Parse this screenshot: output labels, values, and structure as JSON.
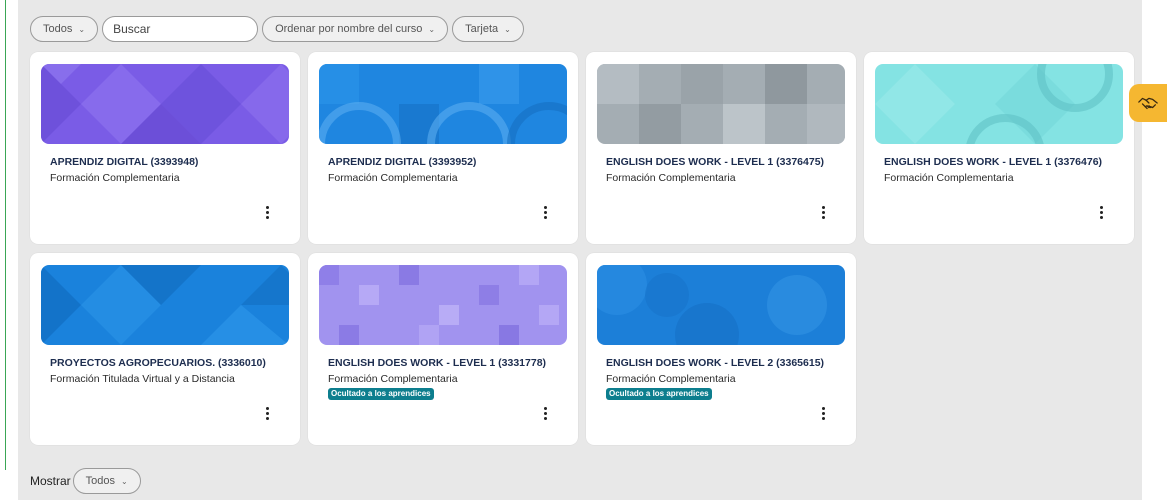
{
  "toolbar": {
    "filter_label": "Todos",
    "search_placeholder": "Buscar",
    "sort_label": "Ordenar por nombre del curso",
    "view_label": "Tarjeta"
  },
  "courses": [
    {
      "title": "APRENDIZ DIGITAL (3393948)",
      "category": "Formación Complementaria",
      "banner_color": "#7a5ce6",
      "hidden_badge": ""
    },
    {
      "title": "APRENDIZ DIGITAL (3393952)",
      "category": "Formación Complementaria",
      "banner_color": "#1f86e0",
      "hidden_badge": ""
    },
    {
      "title": "ENGLISH DOES WORK - LEVEL 1 (3376475)",
      "category": "Formación Complementaria",
      "banner_color": "#a4adb3",
      "hidden_badge": ""
    },
    {
      "title": "ENGLISH DOES WORK - LEVEL 1 (3376476)",
      "category": "Formación Complementaria",
      "banner_color": "#84e3e3",
      "hidden_badge": ""
    },
    {
      "title": "PROYECTOS AGROPECUARIOS. (3336010)",
      "category": "Formación Titulada Virtual y a Distancia",
      "banner_color": "#1a82dc",
      "hidden_badge": ""
    },
    {
      "title": "ENGLISH DOES WORK - LEVEL 1 (3331778)",
      "category": "Formación Complementaria",
      "banner_color": "#a193ef",
      "hidden_badge": "Ocultado a los aprendices"
    },
    {
      "title": "ENGLISH DOES WORK - LEVEL 2 (3365615)",
      "category": "Formación Complementaria",
      "banner_color": "#1c7fd8",
      "hidden_badge": "Ocultado a los aprendices"
    }
  ],
  "footer": {
    "show_label": "Mostrar",
    "show_value": "Todos"
  },
  "colors": {
    "help_button": "#f5b731",
    "badge": "#0d7e8e",
    "panel_background": "#e8e8e8"
  }
}
